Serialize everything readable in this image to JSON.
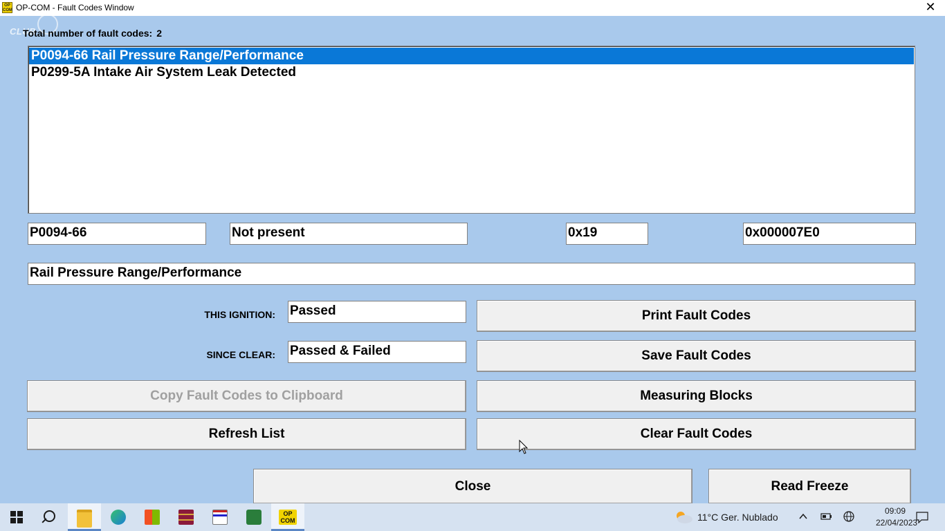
{
  "window": {
    "title": "OP-COM - Fault Codes Window",
    "icon_text": "OP COM",
    "close_glyph": "✕"
  },
  "watermark": "CLUB",
  "summary": {
    "label": "Total number of fault codes:",
    "count": "2"
  },
  "fault_list": [
    {
      "text": "P0094-66 Rail Pressure Range/Performance",
      "selected": true
    },
    {
      "text": "P0299-5A Intake Air System Leak Detected",
      "selected": false
    }
  ],
  "details": {
    "code": "P0094-66",
    "status": "Not present",
    "status_byte": "0x19",
    "address": "0x000007E0",
    "description": "Rail Pressure Range/Performance"
  },
  "test_results": {
    "this_ignition_label": "THIS IGNITION:",
    "this_ignition_value": "Passed",
    "since_clear_label": "SINCE CLEAR:",
    "since_clear_value": "Passed & Failed"
  },
  "buttons": {
    "print": "Print Fault Codes",
    "save": "Save Fault Codes",
    "copy": "Copy Fault Codes to Clipboard",
    "measuring": "Measuring Blocks",
    "refresh": "Refresh List",
    "clear": "Clear Fault Codes",
    "close": "Close",
    "freeze": "Read Freeze"
  },
  "taskbar": {
    "icons": [
      "windows-start-icon",
      "search-icon",
      "file-explorer-icon",
      "edge-browser-icon",
      "store-icon",
      "winrar-icon",
      "app-icon",
      "arduino-icon",
      "opcom-icon"
    ],
    "opcom_text": "OP COM",
    "weather": "11°C  Ger. Nublado",
    "time": "09:09",
    "date": "22/04/2023"
  },
  "colors": {
    "background": "#a9c9ec",
    "selection": "#0a78d7",
    "taskbar": "#d6e2f1"
  }
}
